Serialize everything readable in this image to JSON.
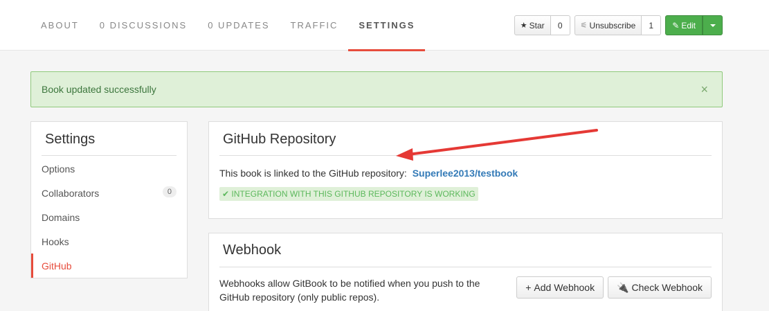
{
  "nav": {
    "tabs": [
      {
        "label": "ABOUT"
      },
      {
        "label": "0 DISCUSSIONS"
      },
      {
        "label": "0 UPDATES"
      },
      {
        "label": "TRAFFIC"
      },
      {
        "label": "SETTINGS"
      }
    ],
    "active_tab": "SETTINGS"
  },
  "toolbar": {
    "star_label": "Star",
    "star_count": "0",
    "unsubscribe_label": "Unsubscribe",
    "unsubscribe_count": "1",
    "edit_label": "Edit"
  },
  "alert": {
    "message": "Book updated successfully",
    "close": "×"
  },
  "sidebar": {
    "title": "Settings",
    "items": [
      {
        "label": "Options"
      },
      {
        "label": "Collaborators",
        "badge": "0"
      },
      {
        "label": "Domains"
      },
      {
        "label": "Hooks"
      },
      {
        "label": "GitHub"
      }
    ],
    "active_item": "GitHub"
  },
  "github_panel": {
    "title": "GitHub Repository",
    "text": "This book is linked to the GitHub repository:",
    "repo": "Superlee2013/testbook",
    "status": "INTEGRATION WITH THIS GITHUB REPOSITORY IS WORKING"
  },
  "webhook_panel": {
    "title": "Webhook",
    "text": "Webhooks allow GitBook to be notified when you push to the GitHub repository (only public repos).",
    "add_label": "Add Webhook",
    "check_label": "Check Webhook"
  },
  "colors": {
    "accent": "#e74c3c",
    "success_bg": "#dff0d8",
    "success_text": "#3c763d",
    "link": "#337ab7",
    "edit_button": "#4cae4c"
  }
}
